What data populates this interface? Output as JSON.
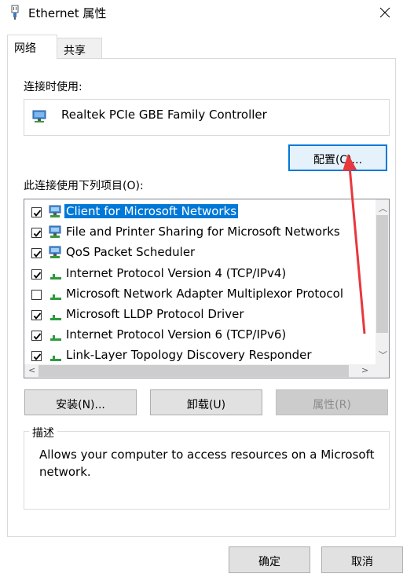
{
  "window": {
    "title": "Ethernet 属性"
  },
  "tabs": [
    {
      "label": "网络",
      "active": true
    },
    {
      "label": "共享",
      "active": false
    }
  ],
  "connect_using": {
    "label": "连接时使用:",
    "adapter": "Realtek PCIe GBE Family Controller",
    "configure_button": "配置(C)..."
  },
  "items_section": {
    "label": "此连接使用下列项目(O):",
    "items": [
      {
        "label": "Client for Microsoft Networks",
        "checked": true,
        "icon": "network-client-icon",
        "selected": true
      },
      {
        "label": "File and Printer Sharing for Microsoft Networks",
        "checked": true,
        "icon": "network-service-icon",
        "selected": false
      },
      {
        "label": "QoS Packet Scheduler",
        "checked": true,
        "icon": "network-service-icon",
        "selected": false
      },
      {
        "label": "Internet Protocol Version 4 (TCP/IPv4)",
        "checked": true,
        "icon": "network-protocol-icon",
        "selected": false
      },
      {
        "label": "Microsoft Network Adapter Multiplexor Protocol",
        "checked": false,
        "icon": "network-protocol-icon",
        "selected": false
      },
      {
        "label": "Microsoft LLDP Protocol Driver",
        "checked": true,
        "icon": "network-protocol-icon",
        "selected": false
      },
      {
        "label": "Internet Protocol Version 6 (TCP/IPv6)",
        "checked": true,
        "icon": "network-protocol-icon",
        "selected": false
      },
      {
        "label": "Link-Layer Topology Discovery Responder",
        "checked": true,
        "icon": "network-protocol-icon",
        "selected": false
      }
    ]
  },
  "actions": {
    "install": "安装(N)...",
    "uninstall": "卸载(U)",
    "properties": "属性(R)"
  },
  "description": {
    "title": "描述",
    "text": "Allows your computer to access resources on a Microsoft network."
  },
  "footer": {
    "ok": "确定",
    "cancel": "取消"
  },
  "colors": {
    "selection": "#0078d7",
    "annotation_arrow": "#e8383d"
  }
}
